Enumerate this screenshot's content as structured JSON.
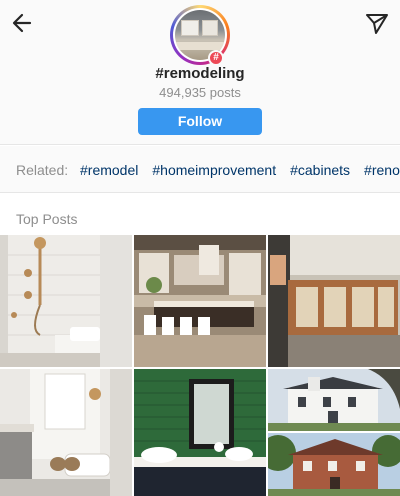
{
  "header": {
    "hashtag": "#remodeling",
    "posts_count": "494,935 posts",
    "follow_label": "Follow",
    "badge_symbol": "#"
  },
  "related": {
    "label": "Related:",
    "tags": [
      "#remodel",
      "#homeimprovement",
      "#cabinets",
      "#renovation"
    ]
  },
  "top_posts": {
    "title": "Top Posts"
  },
  "colors": {
    "accent": "#3897f0",
    "link": "#003569",
    "muted": "#8e8e8e",
    "badge": "#ed4956"
  },
  "icons": {
    "back": "arrow-left-icon",
    "share": "paper-plane-icon"
  }
}
